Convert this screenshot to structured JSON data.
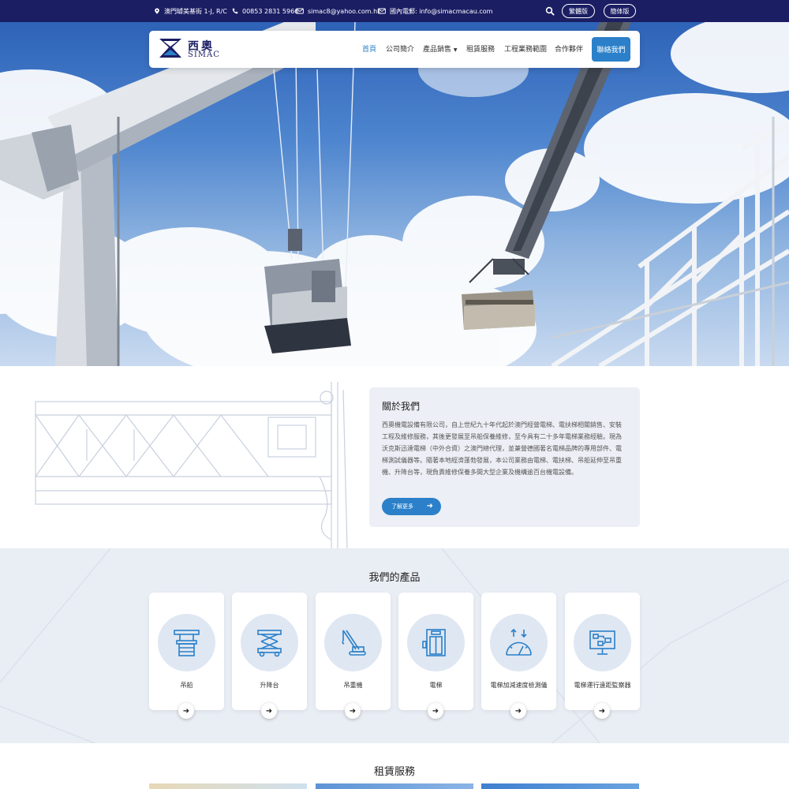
{
  "topbar": {
    "address": "澳門罅美基街 1-J, R/C",
    "phone": "00853 2831 5966",
    "email1": "simac8@yahoo.com.hk",
    "email2": "國內電郵: info@simacmacau.com",
    "lang_trad": "繁體版",
    "lang_simp": "簡体版"
  },
  "nav": {
    "logo_cn": "西奧",
    "logo_en": "SIMAC",
    "items": [
      "首頁",
      "公司簡介",
      "產品銷售",
      "租賃服務",
      "工程業務範圍",
      "合作夥伴"
    ],
    "cta": "聯絡我們"
  },
  "about": {
    "title": "關於我們",
    "body": "西奧機電設備有限公司，自上世紀九十年代起於澳門經營電梯、電扶梯相關銷售、安裝工程及維修服務，其後更發展至吊船保養維修，至今具有二十多年電梯業務經驗。現為沃克斯迅達電梯（中外合資）之澳門總代理，並兼營德國著名電梯品牌的專用部件、電梯測試儀器等。隨著本地經濟蓬勃發展，本公司業務由電梯、電扶梯、吊船延伸至吊重機、升降台等，現負責維修保養多間大型企業及機構逾百台機電設備。",
    "button": "了解更多"
  },
  "products": {
    "title": "我們的產品",
    "items": [
      {
        "label": "吊船",
        "icon": "gondola-icon"
      },
      {
        "label": "升降台",
        "icon": "scissor-lift-icon"
      },
      {
        "label": "吊重機",
        "icon": "crane-icon"
      },
      {
        "label": "電梯",
        "icon": "elevator-icon"
      },
      {
        "label": "電梯加減速度檢測儀",
        "icon": "speed-gauge-icon"
      },
      {
        "label": "電梯運行遠距監察器",
        "icon": "remote-monitor-icon"
      }
    ]
  },
  "rental": {
    "title": "租賃服務"
  },
  "colors": {
    "navy": "#1b1e63",
    "accent": "#2b80c9",
    "products_bg": "#e9edf4"
  }
}
